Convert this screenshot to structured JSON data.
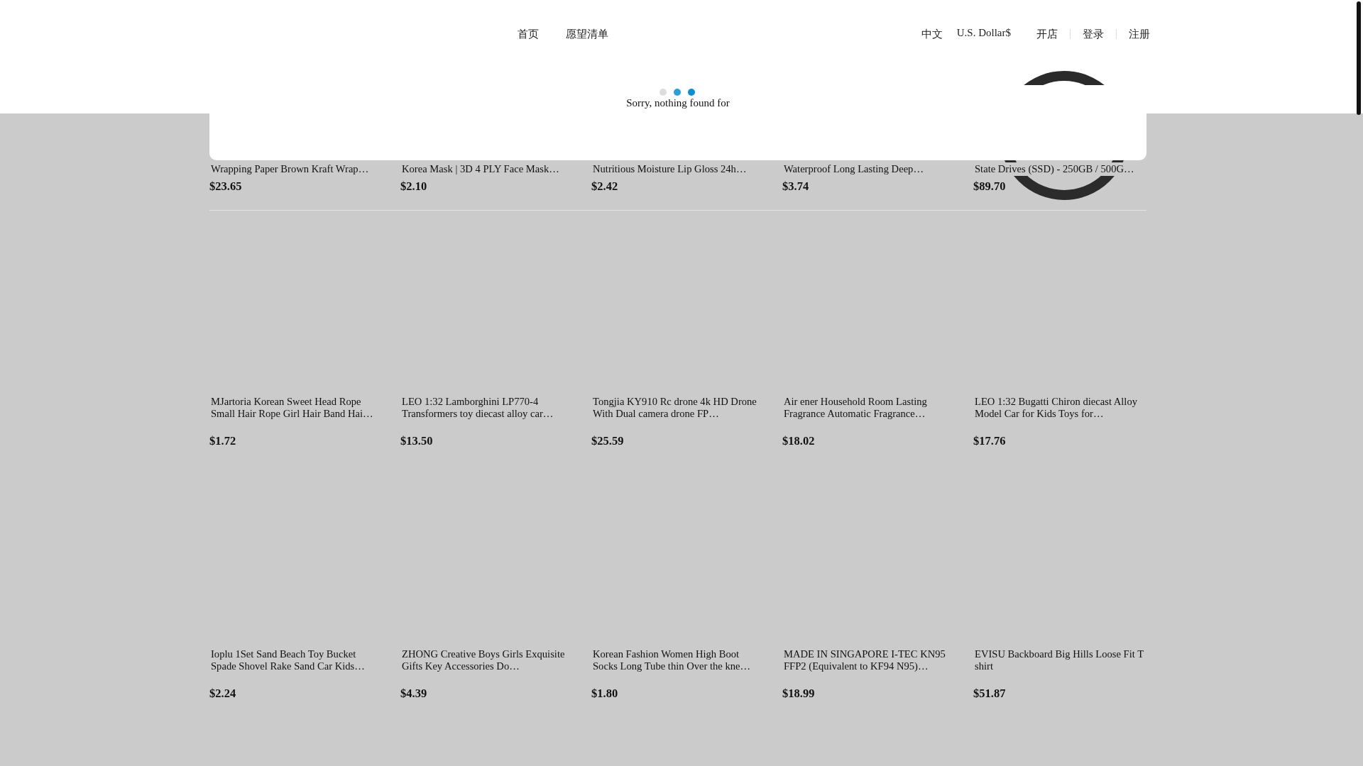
{
  "header": {
    "nav": [
      "首页",
      "愿望清单"
    ],
    "language": "中文",
    "currency": "U.S. Dollar$",
    "account_links": [
      "开店",
      "登录",
      "注册"
    ]
  },
  "search_panel": {
    "message": "Sorry, nothing found for"
  },
  "product_rows": [
    {
      "products": [
        {
          "title": "Wrapping Paper Brown Kraft Wrap…",
          "price": "$23.65"
        },
        {
          "title": "Korea Mask | 3D 4 PLY Face Mask…",
          "price": "$2.10"
        },
        {
          "title": "Nutritious Moisture Lip Gloss 24h…",
          "price": "$2.42"
        },
        {
          "title": "Waterproof Long Lasting Deep…",
          "price": "$3.74"
        },
        {
          "title": "State Drives (SSD) - 250GB / 500G…",
          "price": "$89.70"
        }
      ]
    },
    {
      "products": [
        {
          "title": "MJartoria Korean Sweet Head Rope Small Hair Rope Girl Hair Band Hai…",
          "price": "$1.72"
        },
        {
          "title": "LEO 1:32 Lamborghini LP770-4 Transformers toy diecast alloy car…",
          "price": "$13.50"
        },
        {
          "title": "Tongjia KY910 Rc drone 4k HD Drone With Dual camera drone FP…",
          "price": "$25.59"
        },
        {
          "title": "Air ener Household Room Lasting Fragrance Automatic Fragrance…",
          "price": "$18.02"
        },
        {
          "title": "LEO 1:32 Bugatti Chiron diecast Alloy Model Car for Kids Toys for…",
          "price": "$17.76"
        }
      ]
    },
    {
      "products": [
        {
          "title": "Ioplu 1Set Sand Beach Toy Bucket Spade Shovel Rake Sand Car Kids…",
          "price": "$2.24"
        },
        {
          "title": "ZHONG Creative Boys Girls Exquisite Gifts Key Accessories Do…",
          "price": "$4.39"
        },
        {
          "title": "Korean Fashion Women High Boot Socks Long Tube thin Over the kne…",
          "price": "$1.80"
        },
        {
          "title": "MADE IN SINGAPORE I-TEC KN95 FFP2 (Equivalent to KF94 N95)…",
          "price": "$18.99"
        },
        {
          "title": "EVISU Backboard Big Hills Loose Fit T shirt",
          "price": "$51.87"
        }
      ]
    }
  ]
}
